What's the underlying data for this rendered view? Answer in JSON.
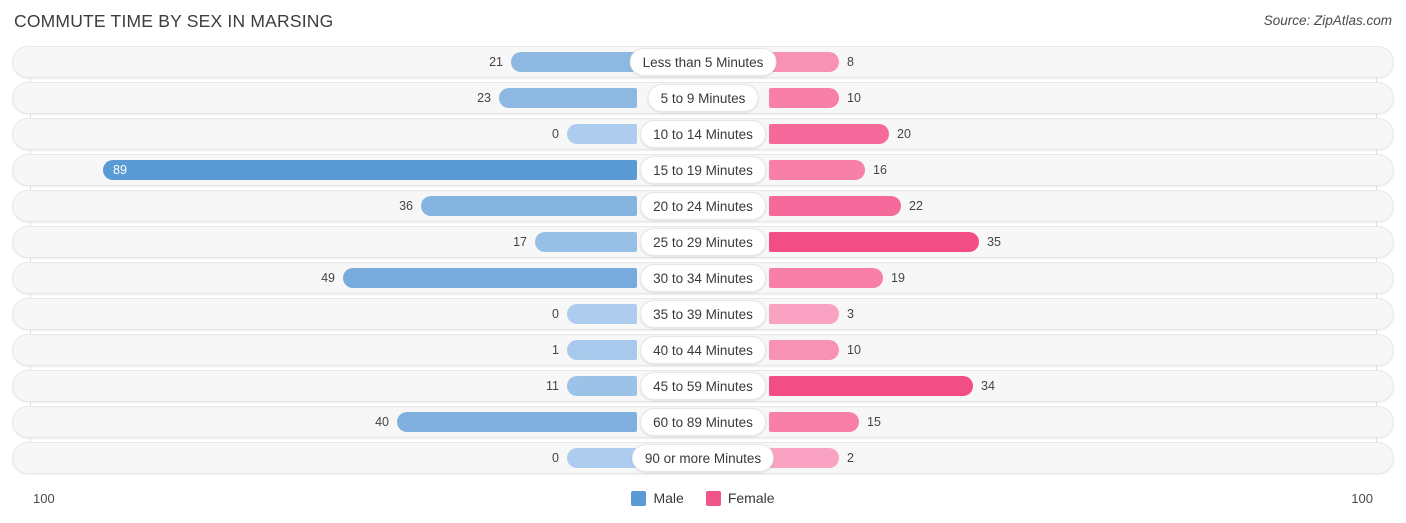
{
  "header": {
    "title": "COMMUTE TIME BY SEX IN MARSING",
    "source": "Source: ZipAtlas.com"
  },
  "legend": {
    "male_label": "Male",
    "female_label": "Female",
    "male_color": "#5b9bd5",
    "female_color": "#f0548a"
  },
  "axis": {
    "left_label": "100",
    "right_label": "100"
  },
  "chart_data": {
    "type": "bar",
    "subtype": "diverging-bidirectional-bar",
    "title": "COMMUTE TIME BY SEX IN MARSING",
    "xlabel": "",
    "ylabel": "",
    "axis_max": 100,
    "axis_left_tick": "100",
    "axis_right_tick": "100",
    "grid": true,
    "legend_position": "bottom-center",
    "categories": [
      "Less than 5 Minutes",
      "5 to 9 Minutes",
      "10 to 14 Minutes",
      "15 to 19 Minutes",
      "20 to 24 Minutes",
      "25 to 29 Minutes",
      "30 to 34 Minutes",
      "35 to 39 Minutes",
      "40 to 44 Minutes",
      "45 to 59 Minutes",
      "60 to 89 Minutes",
      "90 or more Minutes"
    ],
    "series": [
      {
        "name": "Male",
        "direction": "left",
        "color": "#5b9bd5",
        "values": [
          21,
          23,
          0,
          89,
          36,
          17,
          49,
          0,
          1,
          11,
          40,
          0
        ]
      },
      {
        "name": "Female",
        "direction": "right",
        "color": "#f0548a",
        "values": [
          8,
          10,
          20,
          16,
          22,
          35,
          19,
          3,
          10,
          34,
          15,
          2
        ]
      }
    ]
  },
  "rows": [
    {
      "category": "Less than 5 Minutes",
      "male": 21,
      "female": 8,
      "male_text": "21",
      "female_text": "8",
      "male_color": "#8cb8e2",
      "female_color": "#f892b5"
    },
    {
      "category": "5 to 9 Minutes",
      "male": 23,
      "female": 10,
      "male_text": "23",
      "female_text": "10",
      "male_color": "#8cb8e2",
      "female_color": "#f77fa8"
    },
    {
      "category": "10 to 14 Minutes",
      "male": 0,
      "female": 20,
      "male_text": "0",
      "female_text": "20",
      "male_color": "#aecdee",
      "female_color": "#f56a9b"
    },
    {
      "category": "15 to 19 Minutes",
      "male": 89,
      "female": 16,
      "male_text": "89",
      "female_text": "16",
      "male_color": "#5b9bd5",
      "female_color": "#f77fa8"
    },
    {
      "category": "20 to 24 Minutes",
      "male": 36,
      "female": 22,
      "male_text": "36",
      "female_text": "22",
      "male_color": "#85b4e1",
      "female_color": "#f56a9b"
    },
    {
      "category": "25 to 29 Minutes",
      "male": 17,
      "female": 35,
      "male_text": "17",
      "female_text": "35",
      "male_color": "#98c0e6",
      "female_color": "#f24d85"
    },
    {
      "category": "30 to 34 Minutes",
      "male": 49,
      "female": 19,
      "male_text": "49",
      "female_text": "19",
      "male_color": "#77abdd",
      "female_color": "#f77fa8"
    },
    {
      "category": "35 to 39 Minutes",
      "male": 0,
      "female": 3,
      "male_text": "0",
      "female_text": "3",
      "male_color": "#aecdee",
      "female_color": "#f9a2c2"
    },
    {
      "category": "40 to 44 Minutes",
      "male": 1,
      "female": 10,
      "male_text": "1",
      "female_text": "10",
      "male_color": "#a8c9ec",
      "female_color": "#f892b5"
    },
    {
      "category": "45 to 59 Minutes",
      "male": 11,
      "female": 34,
      "male_text": "11",
      "female_text": "34",
      "male_color": "#9cc2e8",
      "female_color": "#f24d85"
    },
    {
      "category": "60 to 89 Minutes",
      "male": 40,
      "female": 15,
      "male_text": "40",
      "female_text": "15",
      "male_color": "#7fb0df",
      "female_color": "#f77fa8"
    },
    {
      "category": "90 or more Minutes",
      "male": 0,
      "female": 2,
      "male_text": "0",
      "female_text": "2",
      "male_color": "#aecdee",
      "female_color": "#f9a2c2"
    }
  ]
}
